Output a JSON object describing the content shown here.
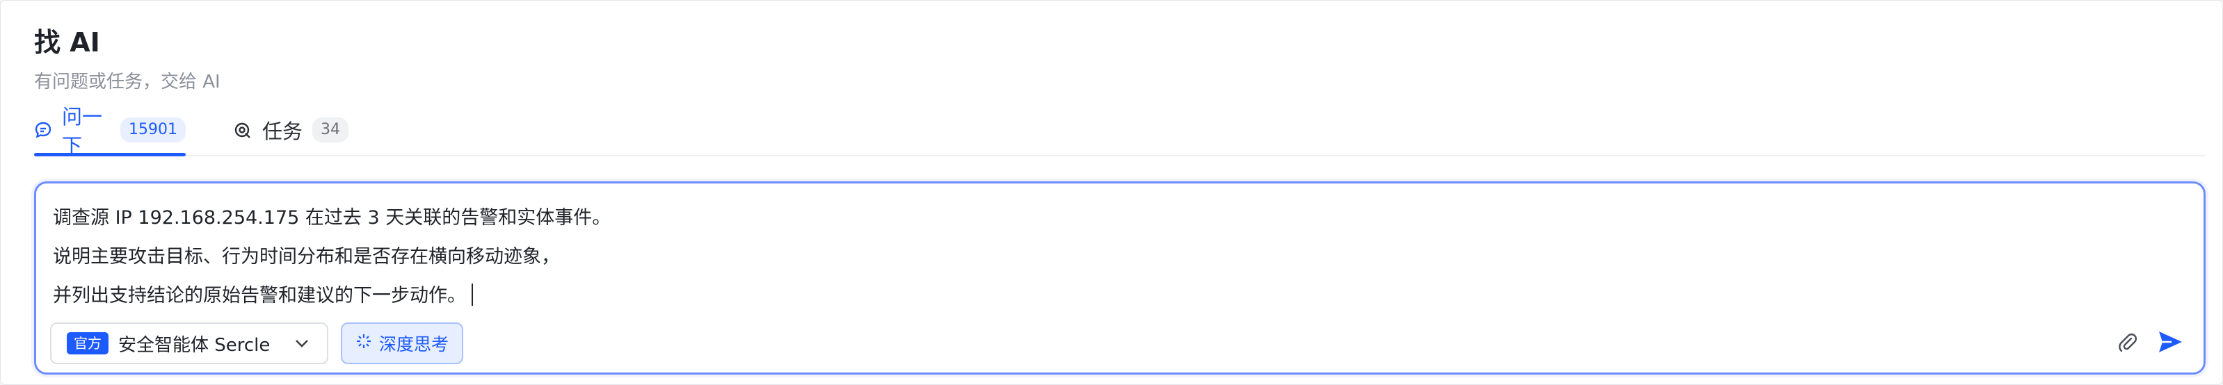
{
  "header": {
    "title": "找 AI",
    "subtitle": "有问题或任务，交给 AI"
  },
  "tabs": [
    {
      "label": "问一下",
      "count": "15901",
      "active": true,
      "icon": "chat-bubble-icon"
    },
    {
      "label": "任务",
      "count": "34",
      "active": false,
      "icon": "task-target-icon"
    }
  ],
  "composer": {
    "lines": [
      "调查源 IP 192.168.254.175 在过去 3 天关联的告警和实体事件。",
      "说明主要攻击目标、行为时间分布和是否存在横向移动迹象，",
      "并列出支持结论的原始告警和建议的下一步动作。"
    ],
    "agent": {
      "badge": "官方",
      "name": "安全智能体 Sercle"
    },
    "deep_think_label": "深度思考",
    "icons": {
      "attach": "paperclip-icon",
      "send": "send-icon",
      "deep_think": "sparkle-icon",
      "chevron": "chevron-down-icon"
    }
  },
  "colors": {
    "accent": "#1e5bff",
    "composer_border": "#6f8cff",
    "subtitle": "#8a8f99"
  }
}
